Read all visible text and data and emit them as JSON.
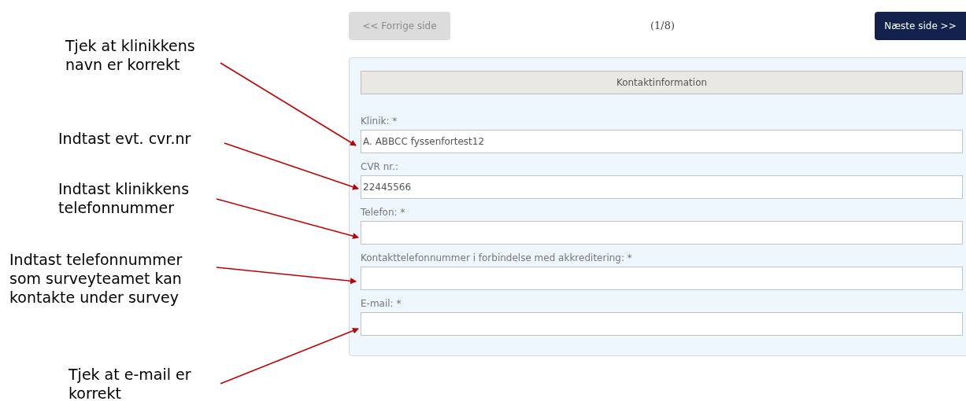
{
  "navigation": {
    "previous": {
      "label": "<< Forrige side",
      "disabled": true
    },
    "page_indicator": "(1/8)",
    "next": {
      "label": "Næste side >>",
      "disabled": false
    }
  },
  "section": {
    "title": "Kontaktinformation"
  },
  "fields": [
    {
      "label": "Klinik: *",
      "value": "A. ABBCC fyssenfortest12"
    },
    {
      "label": "CVR nr.:",
      "value": "22445566"
    },
    {
      "label": "Telefon: *"
    },
    {
      "label": "Kontakttelefonnummer i forbindelse med akkreditering: *"
    },
    {
      "label": "E-mail: *"
    }
  ],
  "annotations": [
    {
      "lines": [
        "Tjek at klinikkens",
        "navn er korrekt"
      ]
    },
    {
      "lines": [
        "Indtast evt. cvr.nr"
      ]
    },
    {
      "lines": [
        "Indtast klinikkens",
        "telefonnummer"
      ]
    },
    {
      "lines": [
        "Indtast telefonnummer",
        "som surveyteamet kan",
        "kontakte under survey"
      ]
    },
    {
      "lines": [
        "Tjek at e-mail er",
        "korrekt"
      ]
    }
  ]
}
